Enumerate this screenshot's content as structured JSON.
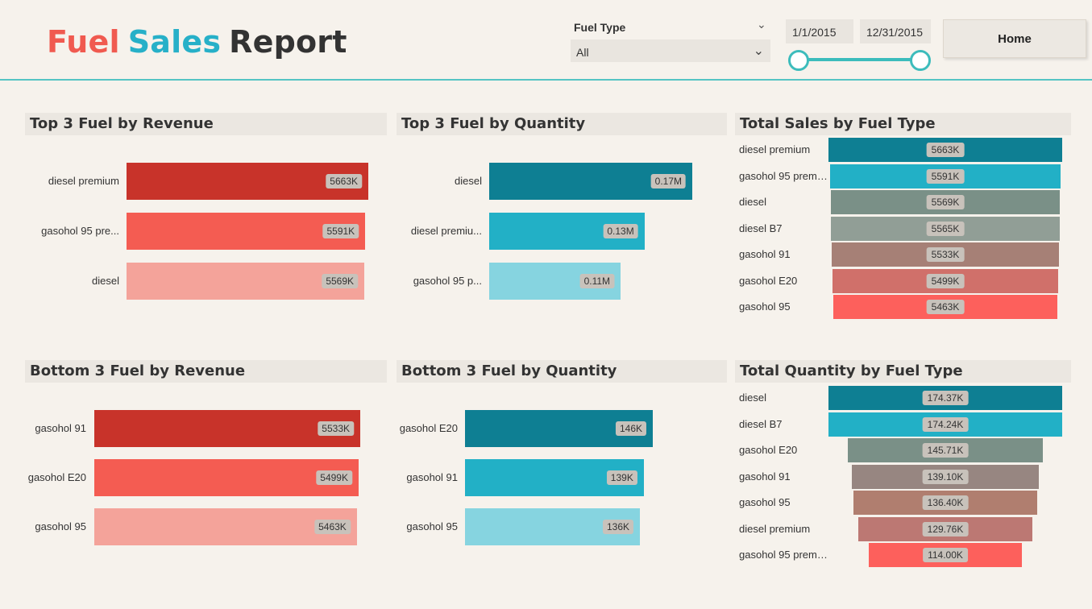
{
  "header": {
    "title_words": [
      {
        "text": "Fuel",
        "color": "#f05a50"
      },
      {
        "text": "Sales",
        "color": "#27b0c8"
      },
      {
        "text": "Report",
        "color": "#333333"
      }
    ],
    "fuel_type_label": "Fuel Type",
    "fuel_type_value": "All",
    "date_start": "1/1/2015",
    "date_end": "12/31/2015",
    "home_label": "Home"
  },
  "panels": {
    "top_revenue": {
      "title": "Top 3 Fuel by Revenue"
    },
    "top_quantity": {
      "title": "Top 3 Fuel by Quantity"
    },
    "total_sales": {
      "title": "Total Sales by Fuel Type"
    },
    "bottom_revenue": {
      "title": "Bottom 3 Fuel by Revenue"
    },
    "bottom_quantity": {
      "title": "Bottom 3 Fuel by Quantity"
    },
    "total_quantity": {
      "title": "Total Quantity by Fuel Type"
    }
  },
  "chart_data": [
    {
      "id": "top_revenue",
      "type": "bar",
      "title": "Top 3 Fuel by Revenue",
      "categories": [
        "diesel premium",
        "gasohol 95 pre...",
        "diesel"
      ],
      "values": [
        5663,
        5591,
        5569
      ],
      "labels": [
        "5663K",
        "5591K",
        "5569K"
      ],
      "colors": [
        "#c8332a",
        "#f45c52",
        "#f4a39a"
      ]
    },
    {
      "id": "top_quantity",
      "type": "bar",
      "title": "Top 3 Fuel by Quantity",
      "categories": [
        "diesel",
        "diesel premiu...",
        "gasohol 95 p..."
      ],
      "values": [
        0.17,
        0.13,
        0.11
      ],
      "labels": [
        "0.17M",
        "0.13M",
        "0.11M"
      ],
      "colors": [
        "#0e7f93",
        "#22b0c6",
        "#86d4e0"
      ]
    },
    {
      "id": "total_sales",
      "type": "bar",
      "title": "Total Sales by Fuel Type",
      "categories": [
        "diesel premium",
        "gasohol 95 premiu...",
        "diesel",
        "diesel B7",
        "gasohol 91",
        "gasohol E20",
        "gasohol 95"
      ],
      "values": [
        5663,
        5591,
        5569,
        5565,
        5533,
        5499,
        5463
      ],
      "labels": [
        "5663K",
        "5591K",
        "5569K",
        "5565K",
        "5533K",
        "5499K",
        "5463K"
      ],
      "colors": [
        "#0e7f93",
        "#22b0c6",
        "#7a9087",
        "#919e96",
        "#a68076",
        "#d0706a",
        "#fd605c"
      ]
    },
    {
      "id": "bottom_revenue",
      "type": "bar",
      "title": "Bottom 3 Fuel by Revenue",
      "categories": [
        "gasohol 91",
        "gasohol E20",
        "gasohol 95"
      ],
      "values": [
        5533,
        5499,
        5463
      ],
      "labels": [
        "5533K",
        "5499K",
        "5463K"
      ],
      "colors": [
        "#c8332a",
        "#f45c52",
        "#f4a39a"
      ]
    },
    {
      "id": "bottom_quantity",
      "type": "bar",
      "title": "Bottom 3 Fuel by Quantity",
      "categories": [
        "gasohol E20",
        "gasohol 91",
        "gasohol 95"
      ],
      "values": [
        146,
        139,
        136
      ],
      "labels": [
        "146K",
        "139K",
        "136K"
      ],
      "colors": [
        "#0e7f93",
        "#22b0c6",
        "#86d4e0"
      ]
    },
    {
      "id": "total_quantity",
      "type": "bar",
      "title": "Total Quantity by Fuel Type",
      "categories": [
        "diesel",
        "diesel B7",
        "gasohol E20",
        "gasohol 91",
        "gasohol 95",
        "diesel premium",
        "gasohol 95 premiu..."
      ],
      "values": [
        174.37,
        174.24,
        145.71,
        139.1,
        136.4,
        129.76,
        114.0
      ],
      "labels": [
        "174.37K",
        "174.24K",
        "145.71K",
        "139.10K",
        "136.40K",
        "129.76K",
        "114.00K"
      ],
      "colors": [
        "#0e7f93",
        "#22b0c6",
        "#7a9087",
        "#978681",
        "#b07e6f",
        "#bc7873",
        "#fd605c"
      ]
    }
  ]
}
